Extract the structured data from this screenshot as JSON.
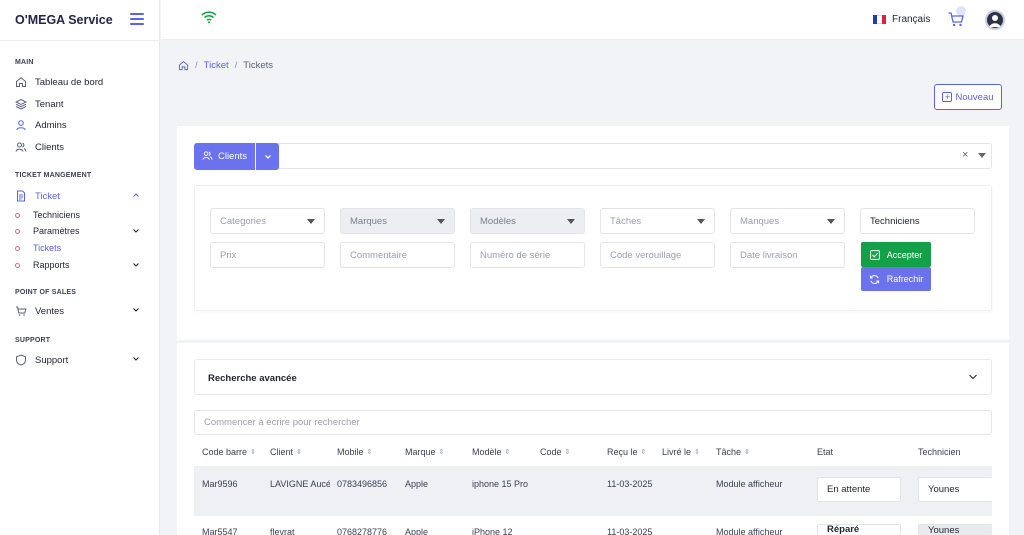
{
  "sidebar": {
    "brand": "O'MEGA Service",
    "sections": {
      "main": "MAIN",
      "ticket": "TICKET MANGEMENT",
      "pos": "POINT OF SALES",
      "support": "SUPPORT"
    },
    "items": {
      "dashboard": "Tableau de bord",
      "tenant": "Tenant",
      "admins": "Admins",
      "clients": "Clients",
      "ticket": "Ticket",
      "techniciens": "Techniciens",
      "parametres": "Paramètres",
      "tickets": "Tickets",
      "rapports": "Rapports",
      "ventes": "Ventes",
      "support": "Support"
    }
  },
  "topbar": {
    "language": "Français",
    "flag_colors": [
      "#1f3fb0",
      "#ffffff",
      "#e0203a"
    ]
  },
  "breadcrumb": {
    "home_icon": "home-icon",
    "items": [
      "Ticket",
      "Tickets"
    ]
  },
  "actions": {
    "new_label": "Nouveau"
  },
  "client_selector": {
    "label": "Clients",
    "clear": "×"
  },
  "filters": {
    "categories": "Categories",
    "marques": "Marques",
    "modeles": "Modèles",
    "taches": "Tâches",
    "manques": "Manques",
    "techniciens": "Techniciens",
    "prix": "Prix",
    "commentaire": "Commentaire",
    "numero_serie": "Numéro de série",
    "code_verrouillage": "Code verouillage",
    "date_livraison": "Date livraison",
    "accept_label": "Accepter",
    "refresh_label": "Rafrechir"
  },
  "advanced_search": {
    "label": "Recherche avancée"
  },
  "search": {
    "placeholder": "Commencer à écrire pour rechercher"
  },
  "table": {
    "columns": {
      "code_barre": "Code barre",
      "client": "Client",
      "mobile": "Mobile",
      "marque": "Marque",
      "modele": "Modèle",
      "code": "Code",
      "recu_le": "Reçu le",
      "livre_le": "Livré le",
      "tache": "Tâche",
      "etat": "Etat",
      "technicien": "Technicien"
    },
    "sort_glyph": "⇕",
    "rows": [
      {
        "code_barre": "Mar9596",
        "client": "LAVIGNE Aucéane",
        "mobile": "0783496856",
        "marque": "Apple",
        "modele": "iphone 15 Pro",
        "recu_le": "11-03-2025",
        "tache": "Module afficheur",
        "etat": "En attente",
        "technicien": "Younes"
      },
      {
        "code_barre": "Mar5547",
        "client": "flevrat",
        "mobile": "0768278776",
        "marque": "Apple",
        "modele": "iPhone 12",
        "recu_le": "11-03-2025",
        "tache": "Module afficheur",
        "etat": "Réparé",
        "technicien": "Younes"
      }
    ]
  },
  "colors": {
    "accent": "#5a63e8",
    "button_primary": "#6b72ee",
    "success": "#12a146"
  }
}
